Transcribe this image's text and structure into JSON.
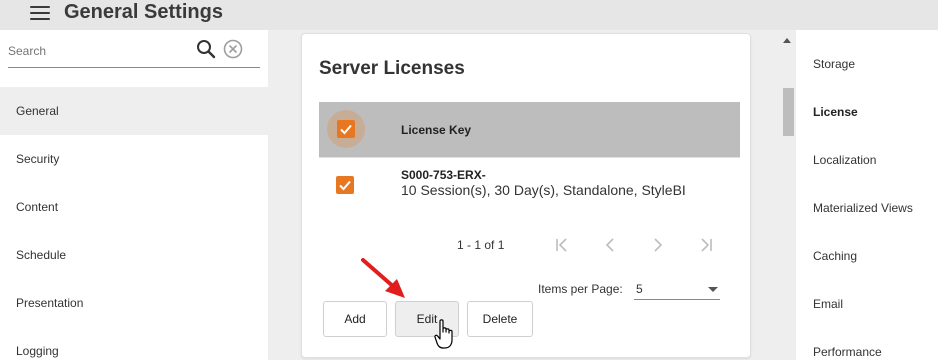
{
  "header": {
    "title": "General Settings",
    "menu_icon": "menu-icon"
  },
  "sidebar": {
    "search": {
      "placeholder": "Search",
      "value": ""
    },
    "items": [
      {
        "label": "General",
        "active": true
      },
      {
        "label": "Security",
        "active": false
      },
      {
        "label": "Content",
        "active": false
      },
      {
        "label": "Schedule",
        "active": false
      },
      {
        "label": "Presentation",
        "active": false
      },
      {
        "label": "Logging",
        "active": false
      }
    ]
  },
  "card": {
    "title": "Server Licenses",
    "columns": [
      "License Key"
    ],
    "rows": [
      {
        "key": "S000-753-ERX-",
        "description": "10 Session(s), 30 Day(s), Standalone, StyleBI",
        "checked": true
      }
    ],
    "header_checked": true,
    "pager": {
      "range": "1 - 1 of 1"
    },
    "items_per_page": {
      "label": "Items per Page:",
      "value": "5"
    },
    "buttons": {
      "add": "Add",
      "edit": "Edit",
      "delete": "Delete"
    }
  },
  "right_nav": {
    "items": [
      {
        "label": "Storage",
        "active": false
      },
      {
        "label": "License",
        "active": true
      },
      {
        "label": "Localization",
        "active": false
      },
      {
        "label": "Materialized Views",
        "active": false
      },
      {
        "label": "Caching",
        "active": false
      },
      {
        "label": "Email",
        "active": false
      },
      {
        "label": "Performance",
        "active": false
      }
    ]
  },
  "colors": {
    "accent": "#e87722",
    "header_bg": "#bdbdbd",
    "annotation": "#e11d1d"
  }
}
